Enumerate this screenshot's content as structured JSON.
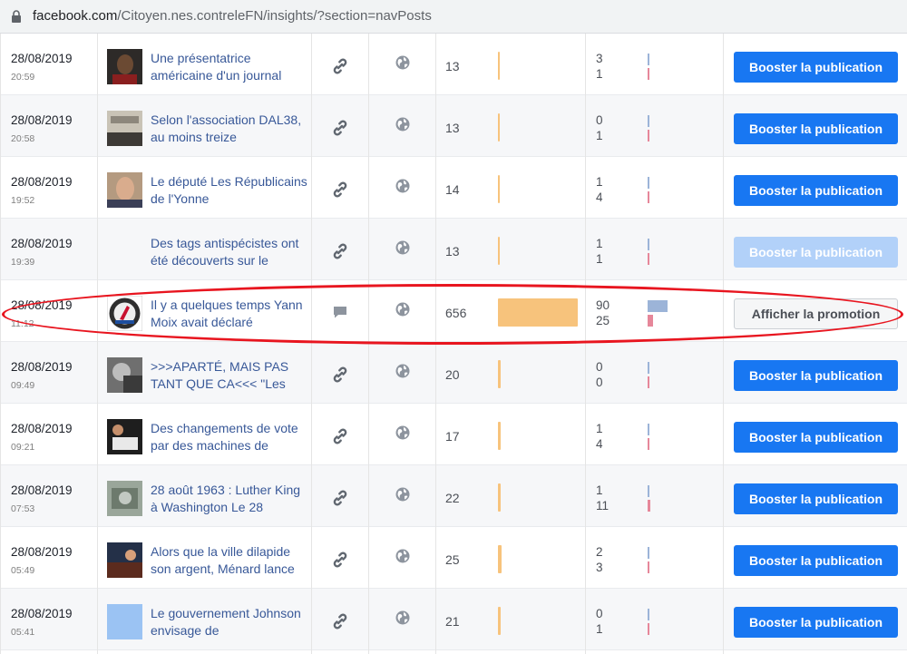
{
  "browser": {
    "url_host": "facebook.com",
    "url_path": "/Citoyen.nes.contreleFN/insights/?section=navPosts"
  },
  "posts": [
    {
      "date": "28/08/2019",
      "time": "20:59",
      "title": "Une présentatrice américaine d'un journal",
      "type_icon": "link-icon",
      "reach": "13",
      "reach_fraction": 0.02,
      "eng_top": "3",
      "eng_bottom": "1",
      "eng_top_fraction": 0.04,
      "eng_bottom_fraction": 0.02,
      "button_label": "Booster la publication",
      "button_state": "primary"
    },
    {
      "date": "28/08/2019",
      "time": "20:58",
      "title": "Selon l'association DAL38, au moins treize",
      "type_icon": "link-icon",
      "reach": "13",
      "reach_fraction": 0.02,
      "eng_top": "0",
      "eng_bottom": "1",
      "eng_top_fraction": 0.02,
      "eng_bottom_fraction": 0.02,
      "button_label": "Booster la publication",
      "button_state": "primary"
    },
    {
      "date": "28/08/2019",
      "time": "19:52",
      "title": "Le député Les Républicains de l'Yonne",
      "type_icon": "link-icon",
      "reach": "14",
      "reach_fraction": 0.02,
      "eng_top": "1",
      "eng_bottom": "4",
      "eng_top_fraction": 0.02,
      "eng_bottom_fraction": 0.04,
      "button_label": "Booster la publication",
      "button_state": "primary"
    },
    {
      "date": "28/08/2019",
      "time": "19:39",
      "title": "Des tags antispécistes ont été découverts sur le",
      "type_icon": "link-icon",
      "reach": "13",
      "reach_fraction": 0.02,
      "eng_top": "1",
      "eng_bottom": "1",
      "eng_top_fraction": 0.02,
      "eng_bottom_fraction": 0.02,
      "button_label": "Booster la publication",
      "button_state": "disabled"
    },
    {
      "date": "28/08/2019",
      "time": "11:12",
      "title": "Il y a quelques temps Yann Moix avait déclaré",
      "type_icon": "comment-icon",
      "reach": "656",
      "reach_fraction": 1.0,
      "eng_top": "90",
      "eng_bottom": "25",
      "eng_top_fraction": 1.0,
      "eng_bottom_fraction": 0.28,
      "button_label": "Afficher la promotion",
      "button_state": "secondary"
    },
    {
      "date": "28/08/2019",
      "time": "09:49",
      "title": ">>>APARTÉ, MAIS PAS TANT QUE CA<<< \"Les",
      "type_icon": "link-icon",
      "reach": "20",
      "reach_fraction": 0.03,
      "eng_top": "0",
      "eng_bottom": "0",
      "eng_top_fraction": 0.02,
      "eng_bottom_fraction": 0.02,
      "button_label": "Booster la publication",
      "button_state": "primary"
    },
    {
      "date": "28/08/2019",
      "time": "09:21",
      "title": "Des changements de vote par des machines de",
      "type_icon": "link-icon",
      "reach": "17",
      "reach_fraction": 0.03,
      "eng_top": "1",
      "eng_bottom": "4",
      "eng_top_fraction": 0.02,
      "eng_bottom_fraction": 0.04,
      "button_label": "Booster la publication",
      "button_state": "primary"
    },
    {
      "date": "28/08/2019",
      "time": "07:53",
      "title": "28 août 1963 : Luther King à Washington Le 28",
      "type_icon": "link-icon",
      "reach": "22",
      "reach_fraction": 0.03,
      "eng_top": "1",
      "eng_bottom": "11",
      "eng_top_fraction": 0.02,
      "eng_bottom_fraction": 0.12,
      "button_label": "Booster la publication",
      "button_state": "primary"
    },
    {
      "date": "28/08/2019",
      "time": "05:49",
      "title": "Alors que la ville dilapide son argent, Ménard lance",
      "type_icon": "link-icon",
      "reach": "25",
      "reach_fraction": 0.04,
      "eng_top": "2",
      "eng_bottom": "3",
      "eng_top_fraction": 0.03,
      "eng_bottom_fraction": 0.03,
      "button_label": "Booster la publication",
      "button_state": "primary"
    },
    {
      "date": "28/08/2019",
      "time": "05:41",
      "title": "Le gouvernement Johnson envisage de",
      "type_icon": "link-icon",
      "reach": "21",
      "reach_fraction": 0.03,
      "eng_top": "0",
      "eng_bottom": "1",
      "eng_top_fraction": 0.02,
      "eng_bottom_fraction": 0.02,
      "button_label": "Booster la publication",
      "button_state": "primary"
    }
  ],
  "colors": {
    "link": "#385898",
    "reach_bar": "#f7c37c",
    "engagement_top_bar": "#9cb4d8",
    "engagement_bottom_bar": "#e6879a",
    "boost_button": "#1877f2",
    "highlight_ellipse": "#e8151f"
  }
}
